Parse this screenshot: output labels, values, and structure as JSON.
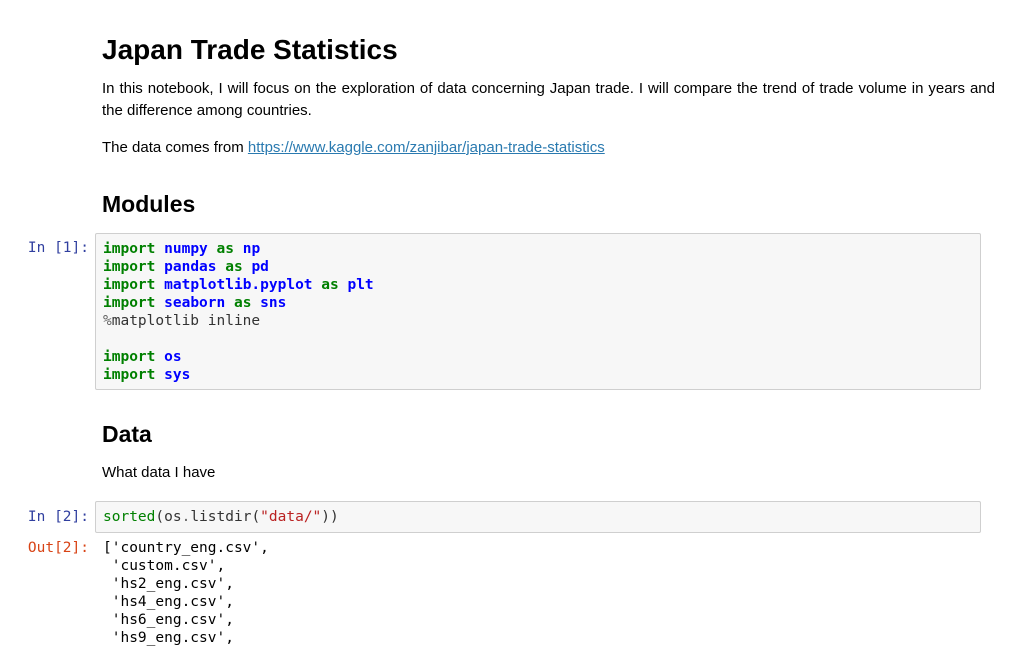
{
  "intro": {
    "title": "Japan Trade Statistics",
    "paragraph": "In this notebook, I will focus on the exploration of data concerning Japan trade. I will compare the trend of trade volume in years and the difference among countries.",
    "source_prefix": "The data comes from ",
    "source_link": "https://www.kaggle.com/zanjibar/japan-trade-statistics"
  },
  "modules": {
    "heading": "Modules",
    "prompt": "In [1]:",
    "code": {
      "import_kw": "import",
      "as_kw": "as",
      "magic_symbol": "%",
      "magic_text": "matplotlib inline",
      "lines": [
        {
          "module": "numpy",
          "alias": "np"
        },
        {
          "module": "pandas",
          "alias": "pd"
        },
        {
          "module": "matplotlib.pyplot",
          "alias": "plt"
        },
        {
          "module": "seaborn",
          "alias": "sns"
        }
      ],
      "extra_imports": [
        "os",
        "sys"
      ]
    }
  },
  "data_section": {
    "heading": "Data",
    "description": "What data I have",
    "in_prompt": "In [2]:",
    "code": {
      "fn": "sorted",
      "open_paren": "(",
      "obj": "os",
      "dot": ".",
      "method": "listdir",
      "arg": "\"data/\"",
      "close_paren": "))"
    },
    "out_prompt": "Out[2]:",
    "output_lines": [
      "['country_eng.csv',",
      " 'custom.csv',",
      " 'hs2_eng.csv',",
      " 'hs4_eng.csv',",
      " 'hs6_eng.csv',",
      " 'hs9_eng.csv',"
    ]
  }
}
